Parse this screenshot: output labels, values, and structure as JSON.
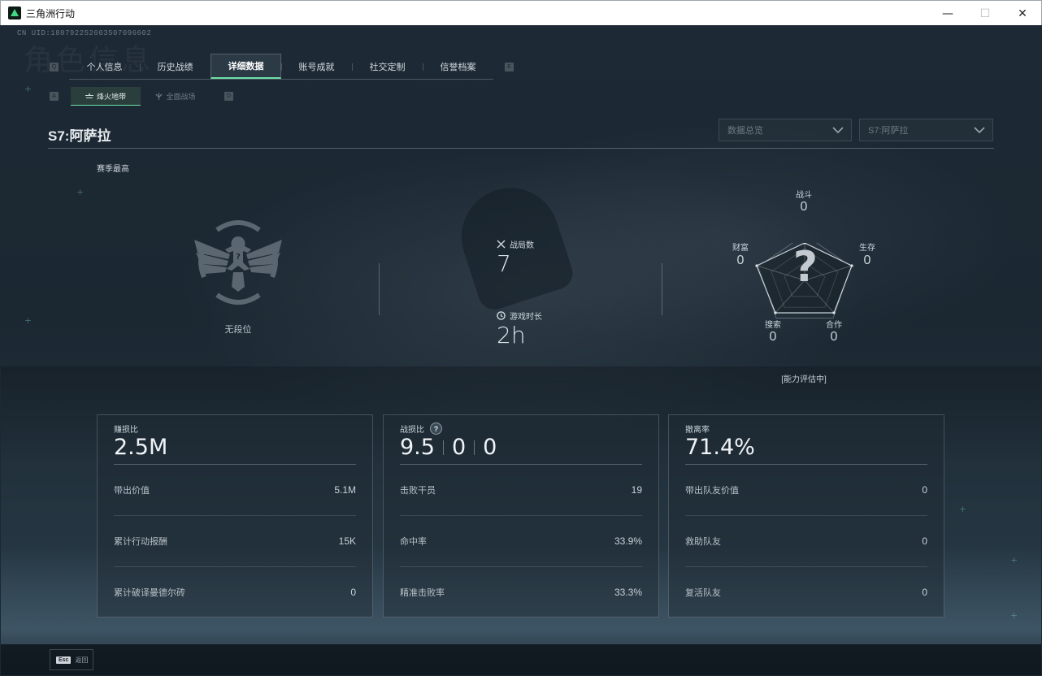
{
  "window": {
    "title": "三角洲行动",
    "minimize": "—",
    "maximize": "☐",
    "close": "✕"
  },
  "uid": "CN UID:1887922526035070966​02",
  "watermark": "角色信息",
  "key_hints": {
    "tabs_left": "Q",
    "tabs_right": "E",
    "subtabs_left": "A",
    "subtabs_right": "D"
  },
  "tabs": [
    {
      "label": "个人信息"
    },
    {
      "label": "历史战绩"
    },
    {
      "label": "详细数据"
    },
    {
      "label": "账号成就"
    },
    {
      "label": "社交定制"
    },
    {
      "label": "信誉档案"
    }
  ],
  "active_tab": "详细数据",
  "subtabs": [
    {
      "label": "烽火地带"
    },
    {
      "label": "全面战场"
    }
  ],
  "season": {
    "title": "S7:阿萨拉",
    "best_label": "赛季最高"
  },
  "dropdowns": {
    "view": "数据总览",
    "season": "S7:阿萨拉"
  },
  "rank": {
    "label": "无段位"
  },
  "matches": {
    "label": "战局数",
    "value": "7"
  },
  "playtime": {
    "label": "游戏时长",
    "value": "2h"
  },
  "radar": {
    "combat_label": "战斗",
    "combat_value": "0",
    "survival_label": "生存",
    "survival_value": "0",
    "coop_label": "合作",
    "coop_value": "0",
    "search_label": "搜索",
    "search_value": "0",
    "wealth_label": "财富",
    "wealth_value": "0",
    "unknown": "?",
    "status": "[能力评估中]"
  },
  "cards": {
    "profit": {
      "title": "赚损比",
      "main": "2.5M",
      "rows": [
        {
          "label": "带出价值",
          "value": "5.1M"
        },
        {
          "label": "累计行动报酬",
          "value": "15K"
        },
        {
          "label": "累计破译曼德尔砖",
          "value": "0"
        }
      ]
    },
    "kd": {
      "title": "战损比",
      "help": "?",
      "main_a": "9.5",
      "main_b": "0",
      "main_c": "0",
      "rows": [
        {
          "label": "击败干员",
          "value": "19"
        },
        {
          "label": "命中率",
          "value": "33.9%"
        },
        {
          "label": "精准击败率",
          "value": "33.3%"
        }
      ]
    },
    "extract": {
      "title": "撤离率",
      "main": "71.4%",
      "rows": [
        {
          "label": "带出队友价值",
          "value": "0"
        },
        {
          "label": "救助队友",
          "value": "0"
        },
        {
          "label": "复活队友",
          "value": "0"
        }
      ]
    }
  },
  "back": {
    "key": "Esc",
    "label": "返回"
  }
}
